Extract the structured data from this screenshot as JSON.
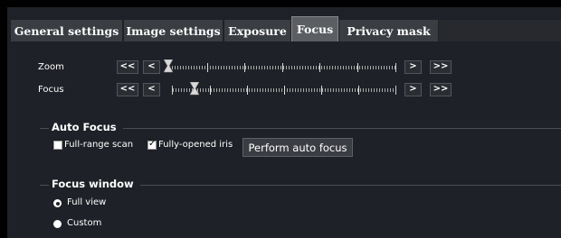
{
  "tabs": [
    {
      "label": "General settings"
    },
    {
      "label": "Image settings"
    },
    {
      "label": "Exposure"
    },
    {
      "label": "Focus"
    },
    {
      "label": "Privacy mask"
    }
  ],
  "active_tab": "Focus",
  "zoom": {
    "label": "Zoom",
    "btn_far_left": "<<",
    "btn_left": "<",
    "btn_right": ">",
    "btn_far_right": ">>",
    "position": 0
  },
  "focus": {
    "label": "Focus",
    "btn_far_left": "<<",
    "btn_left": "<",
    "btn_right": ">",
    "btn_far_right": ">>",
    "position": 0.1
  },
  "auto_focus": {
    "title": "Auto Focus",
    "full_range_scan": {
      "label": "Full-range scan",
      "checked": false
    },
    "fully_opened_iris": {
      "label": "Fully-opened iris",
      "checked": true
    },
    "perform_button": "Perform auto focus"
  },
  "focus_window": {
    "title": "Focus window",
    "options": [
      {
        "label": "Full view",
        "selected": true
      },
      {
        "label": "Custom",
        "selected": false
      }
    ]
  }
}
